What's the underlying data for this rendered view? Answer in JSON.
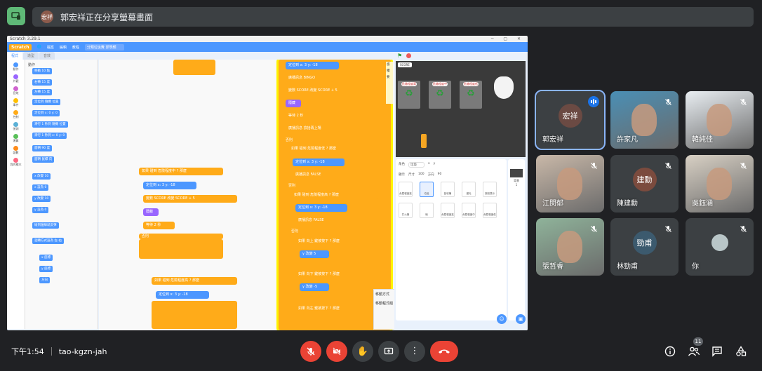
{
  "banner": {
    "avatar_text": "宏祥",
    "text": "郭宏祥正在分享螢幕畫面"
  },
  "scratch": {
    "window_title": "Scratch 3.29.1",
    "logo": "Scratch",
    "menu": [
      "檔案",
      "編輯",
      "教程"
    ],
    "project_name": "分類垃圾費 郭學顏",
    "tabs": [
      "程式",
      "造型",
      "音效"
    ],
    "categories": [
      "動作",
      "外觀",
      "音效",
      "事件",
      "控制",
      "偵測",
      "運算",
      "變數",
      "我的積木"
    ],
    "category_colors": [
      "#4c97ff",
      "#9966ff",
      "#cf63cf",
      "#ffbf00",
      "#ffab19",
      "#5cb1d6",
      "#59c059",
      "#ff8c1a",
      "#ff6680"
    ],
    "palette_heading": "動作",
    "palette_blocks": [
      "移動 10 點",
      "右轉 15 度",
      "左轉 15 度",
      "定位到 隨機 位置",
      "定位到 x: 0 y: 0",
      "滑行 1 秒到 隨機 位置",
      "滑行 1 秒到 x: 0 y: 0",
      "面朝 90 度",
      "面朝 鼠標 向",
      "x 改變 10",
      "x 設為 0",
      "y 改變 10",
      "y 設為 0",
      "碰到邊緣就反彈",
      "迴轉方式設為 左-右",
      "x 座標",
      "y 座標",
      "方向"
    ],
    "workspace_blocks": {
      "if1": "如果 碰到 危險程度中 ? 那麼",
      "goto1": "定位到 x: 3 y: -18",
      "change1": "變數 SCORE 改變 SCORE + 5",
      "hide": "隱藏",
      "wait": "等待 2 秒",
      "else": "否則",
      "if2": "如果 碰到 危險程度高 ? 那麼",
      "goto2": "定位到 x: 3 y: -18",
      "r_goto": "定位到 x: 3 y: -18",
      "r_broadcast": "廣播訊息 BINGO",
      "r_change": "變數 SCORE 改變 SCORE + 5",
      "r_hide": "隱藏",
      "r_wait": "等待 2 秒",
      "r_broadcast2": "廣播訊息 撿拾再上場",
      "r_else": "否則",
      "r_if": "如果 碰到 危險程度低 ? 那麼",
      "r_goto2": "定位到 x: 3 y: -18",
      "r_broadcast3": "廣播訊息 FALSE",
      "r_else2": "否則",
      "r_if2": "如果 碰到 危險程度高 ? 那麼",
      "r_goto3": "定位到 x: 3 y: -18",
      "r_broadcast4": "廣播訊息 FALSE",
      "r_else3": "否則",
      "r_if3": "如果 向上 鍵被按下 ? 那麼",
      "r_ychange": "y 改變 5",
      "r_if4": "如果 向下 鍵被按下 ? 那麼",
      "r_ychange2": "y 改變 -5",
      "r_if5": "如果 向左 鍵被按下 ? 那麼"
    },
    "side_text": [
      "感",
      "積",
      "要"
    ],
    "popup": [
      "移動方式",
      "移動程式組"
    ],
    "stage": {
      "score_label": "SCORE",
      "bins": [
        "危險程度高",
        "危險程度中",
        "危險程度低"
      ]
    },
    "sprite_info": {
      "sprite_label": "角色",
      "sprite_name": "垃圾",
      "x": "x",
      "y": "y",
      "show": "顯示",
      "size": "尺寸",
      "direction": "方向",
      "size_val": "100",
      "dir_val": "90"
    },
    "sprites": [
      "危險程度高",
      "垃圾",
      "回收桶",
      "燈光",
      "按鈕提示",
      "打火機",
      "碗",
      "危險程度高",
      "危險程度中",
      "危險程度低"
    ],
    "backdrop_label": "背景",
    "backdrop_count": "1"
  },
  "participants": [
    {
      "name": "郭宏祥",
      "avatar_text": "宏祥",
      "kind": "avatar",
      "color": "#6b4a43",
      "speaking": true
    },
    {
      "name": "許家凡",
      "kind": "video",
      "bg": "#4a8fb5"
    },
    {
      "name": "韓純佳",
      "kind": "video",
      "bg": "#e9eef2"
    },
    {
      "name": "江閔郁",
      "kind": "video",
      "bg": "#c9b8a8"
    },
    {
      "name": "陳建勳",
      "avatar_text": "建勳",
      "kind": "avatar",
      "color": "#7b4b3e"
    },
    {
      "name": "吳鈺涵",
      "kind": "video",
      "bg": "#d8d0c4"
    },
    {
      "name": "張哲睿",
      "kind": "video",
      "bg": "#8fb39a"
    },
    {
      "name": "林勁甫",
      "avatar_text": "勁甫",
      "kind": "avatar",
      "color": "#3c5a6e"
    },
    {
      "name": "你",
      "kind": "video-small",
      "bg": "#3c4043"
    }
  ],
  "bottom": {
    "time": "下午1:54",
    "meeting_code": "tao-kgzn-jah",
    "people_count": "11"
  },
  "colors": {
    "danger": "#ea4335",
    "panel": "#3c4043",
    "bg": "#202124",
    "accent": "#8ab4f8"
  }
}
